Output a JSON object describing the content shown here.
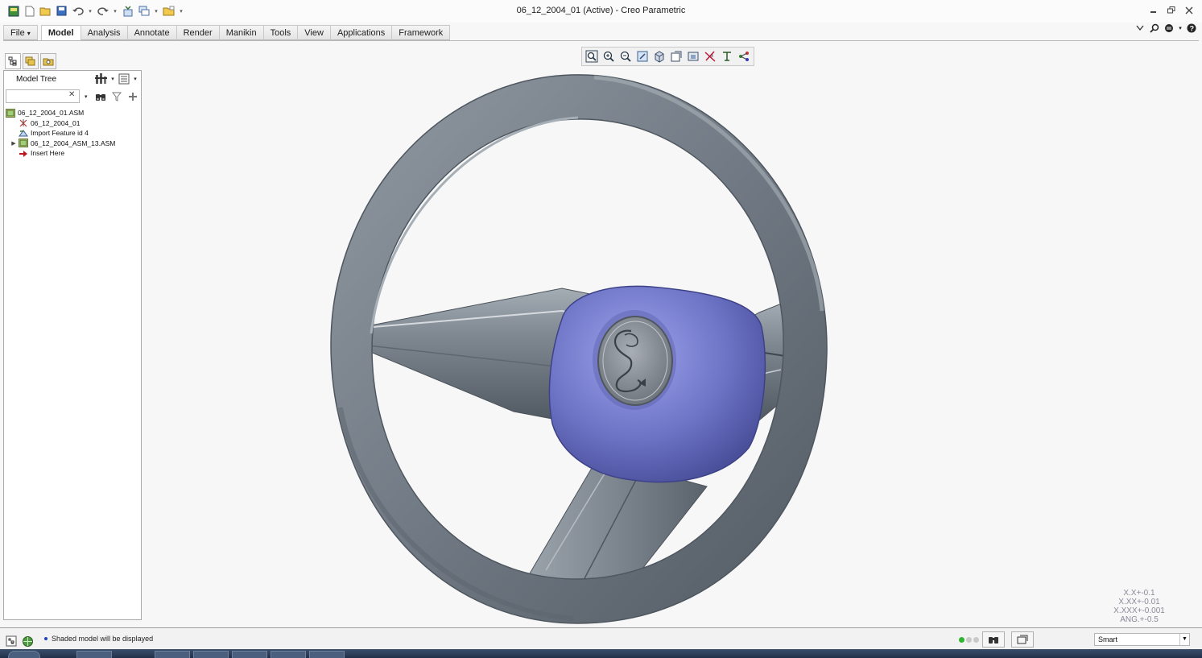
{
  "window": {
    "title": "06_12_2004_01 (Active) - Creo Parametric"
  },
  "quick_access": [
    "new-icon",
    "open-icon",
    "save-icon",
    "undo-icon",
    "redo-icon",
    "regenerate-icon",
    "windows-icon",
    "close-window-icon",
    "customize-icon"
  ],
  "ribbon": {
    "file_label": "File",
    "file_arrow": "▾",
    "tabs": [
      "Model",
      "Analysis",
      "Annotate",
      "Render",
      "Manikin",
      "Tools",
      "View",
      "Applications",
      "Framework"
    ],
    "active_tab": "Model"
  },
  "navigator": {
    "title": "Model Tree",
    "search_value": "",
    "clear_glyph": "✕",
    "tree": [
      {
        "label": "06_12_2004_01.ASM",
        "icon": "assembly-icon",
        "indent": 0,
        "expandable": false
      },
      {
        "label": "06_12_2004_01",
        "icon": "coordinate-system-icon",
        "indent": 1,
        "expandable": false
      },
      {
        "label": "Import Feature id 4",
        "icon": "import-feature-icon",
        "indent": 1,
        "expandable": false
      },
      {
        "label": "06_12_2004_ASM_13.ASM",
        "icon": "assembly-icon",
        "indent": 1,
        "expandable": true
      },
      {
        "label": "Insert Here",
        "icon": "insert-here-icon",
        "indent": 1,
        "expandable": false
      }
    ]
  },
  "graphics": {
    "model": "steering wheel",
    "tolerances": [
      "X.X+-0.1",
      "X.XX+-0.01",
      "X.XXX+-0.001",
      "ANG.+-0.5"
    ]
  },
  "status": {
    "message": "Shaded model will be displayed",
    "selection_filter": "Smart"
  },
  "colors": {
    "ring": "#7b8590",
    "hub": "#6f76c8",
    "spoke": "#8a939d",
    "background": "#f7f7f7",
    "accent": "#1d3fc6"
  }
}
